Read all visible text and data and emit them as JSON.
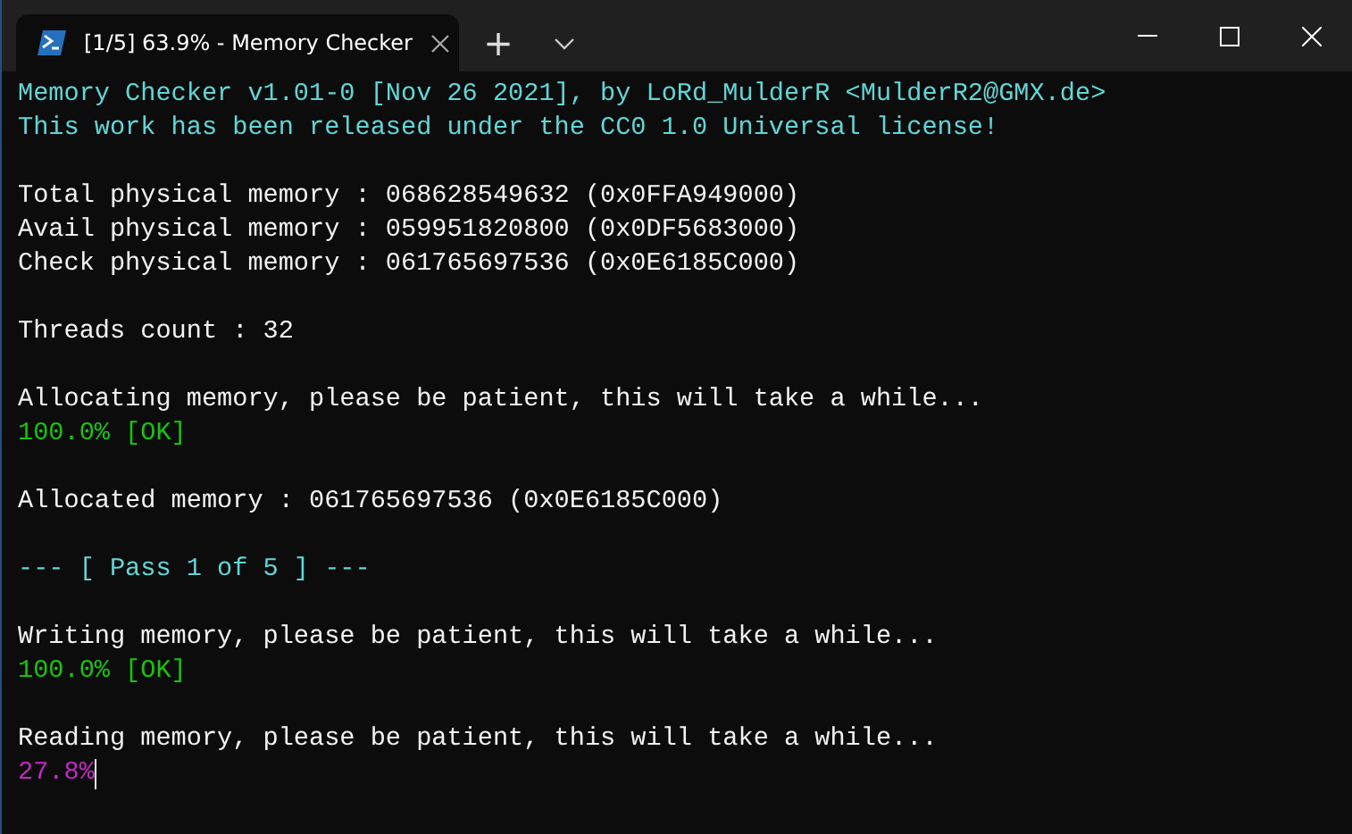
{
  "tabs": [
    {
      "title": "[1/5] 63.9% - Memory Checker",
      "selected": true
    }
  ],
  "new_tab": "+",
  "lines": [
    {
      "kind": "text",
      "color": "#61d6d6",
      "text": "Memory Checker v1.01-0 [Nov 26 2021], by LoRd_MulderR <MulderR2@GMX.de>"
    },
    {
      "kind": "text",
      "color": "#61d6d6",
      "text": "This work has been released under the CC0 1.0 Universal license!"
    },
    {
      "kind": "blank"
    },
    {
      "kind": "text",
      "color": "#f2f2f2",
      "text": "Total physical memory : 068628549632 (0x0FFA949000)"
    },
    {
      "kind": "text",
      "color": "#f2f2f2",
      "text": "Avail physical memory : 059951820800 (0x0DF5683000)"
    },
    {
      "kind": "text",
      "color": "#f2f2f2",
      "text": "Check physical memory : 061765697536 (0x0E6185C000)"
    },
    {
      "kind": "blank"
    },
    {
      "kind": "text",
      "color": "#f2f2f2",
      "text": "Threads count : 32"
    },
    {
      "kind": "blank"
    },
    {
      "kind": "text",
      "color": "#f2f2f2",
      "text": "Allocating memory, please be patient, this will take a while..."
    },
    {
      "kind": "text",
      "color": "#16c60c",
      "text": "100.0% [OK]"
    },
    {
      "kind": "blank"
    },
    {
      "kind": "text",
      "color": "#f2f2f2",
      "text": "Allocated memory : 061765697536 (0x0E6185C000)"
    },
    {
      "kind": "blank"
    },
    {
      "kind": "text",
      "color": "#61d6d6",
      "text": "--- [ Pass 1 of 5 ] ---"
    },
    {
      "kind": "blank"
    },
    {
      "kind": "text",
      "color": "#f2f2f2",
      "text": "Writing memory, please be patient, this will take a while..."
    },
    {
      "kind": "text",
      "color": "#16c60c",
      "text": "100.0% [OK]"
    },
    {
      "kind": "blank"
    },
    {
      "kind": "text",
      "color": "#f2f2f2",
      "text": "Reading memory, please be patient, this will take a while..."
    },
    {
      "kind": "prompt",
      "color": "#c62ac6",
      "text": "27.8%"
    }
  ]
}
